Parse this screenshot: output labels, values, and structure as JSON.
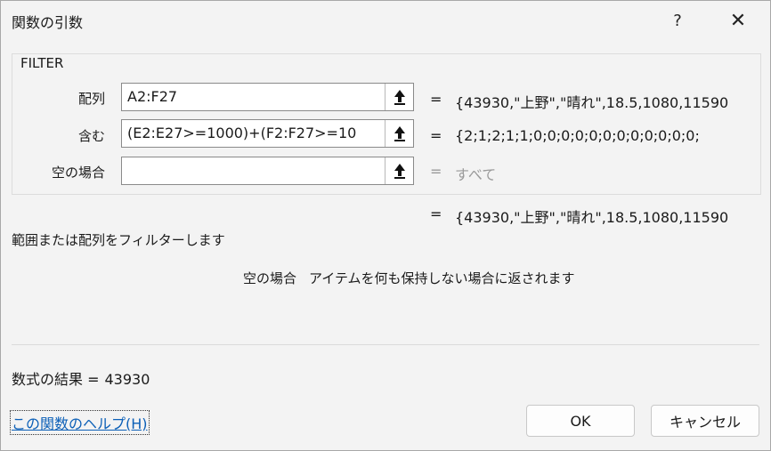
{
  "dialog": {
    "title": "関数の引数",
    "help_button": "?",
    "close_button": "✕"
  },
  "function_group": {
    "name": "FILTER",
    "args": [
      {
        "label": "配列",
        "value": "A2:F27",
        "result": "{43930,\"上野\",\"晴れ\",18.5,1080,11590"
      },
      {
        "label": "含む",
        "value": "(E2:E27>=1000)+(F2:F27>=10",
        "result": "{2;1;2;1;1;0;0;0;0;0;0;0;0;0;0;0;0;"
      },
      {
        "label": "空の場合",
        "value": "",
        "result": "すべて"
      }
    ],
    "equals": "="
  },
  "overall_result": "{43930,\"上野\",\"晴れ\",18.5,1080,11590",
  "description": "範囲または配列をフィルターします",
  "arg_description": {
    "name": "空の場合",
    "text": "アイテムを何も保持しない場合に返されます"
  },
  "formula_result": {
    "label": "数式の結果 =",
    "value": "43930"
  },
  "help_link": "この関数のヘルプ(H)",
  "buttons": {
    "ok": "OK",
    "cancel": "キャンセル"
  },
  "icons": {
    "collapse": "collapse-dialog-arrow-icon"
  }
}
